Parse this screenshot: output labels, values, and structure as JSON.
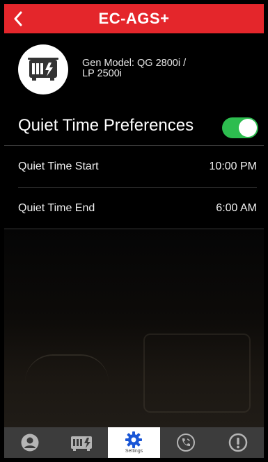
{
  "header": {
    "title": "EC-AGS+",
    "back_icon": "chevron-left-icon",
    "bg_color": "#e4262b"
  },
  "generator": {
    "icon": "generator-icon",
    "model_line1": "Gen Model: QG 2800i /",
    "model_line2": "LP 2500i"
  },
  "quiet_time": {
    "title": "Quiet Time Preferences",
    "enabled": true,
    "toggle_color": "#2dbd4f",
    "rows": [
      {
        "label": "Quiet Time Start",
        "value": "10:00 PM"
      },
      {
        "label": "Quiet Time End",
        "value": "6:00 AM"
      }
    ]
  },
  "tabbar": {
    "tabs": [
      {
        "icon": "user-icon",
        "label": ""
      },
      {
        "icon": "generator-icon",
        "label": ""
      },
      {
        "icon": "gear-icon",
        "label": "Settings",
        "active": true
      },
      {
        "icon": "phone-icon",
        "label": ""
      },
      {
        "icon": "alert-icon",
        "label": ""
      }
    ],
    "accent_color": "#1a56d6"
  }
}
